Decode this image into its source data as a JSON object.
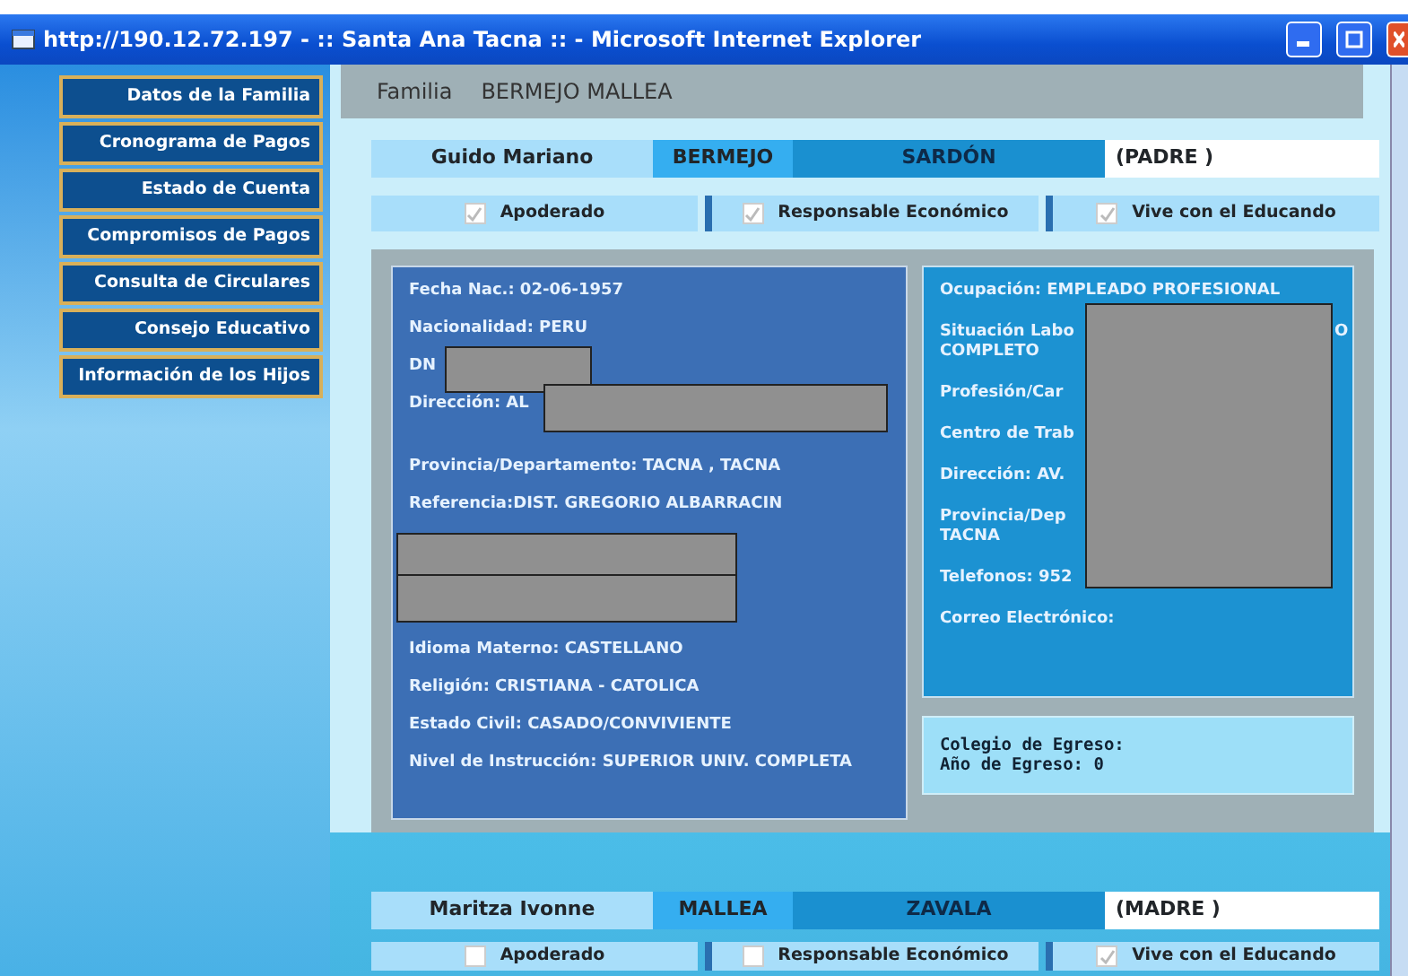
{
  "window": {
    "title": "http://190.12.72.197 - :: Santa Ana Tacna :: - Microsoft Internet Explorer"
  },
  "sidebar": {
    "items": [
      {
        "label": "Datos de la Familia"
      },
      {
        "label": "Cronograma de Pagos"
      },
      {
        "label": "Estado de Cuenta"
      },
      {
        "label": "Compromisos de Pagos"
      },
      {
        "label": "Consulta de Circulares"
      },
      {
        "label": "Consejo Educativo"
      },
      {
        "label": "Información de los Hijos"
      }
    ]
  },
  "header": {
    "label": "Familia",
    "value": "BERMEJO MALLEA"
  },
  "parents": [
    {
      "names": "Guido Mariano",
      "surname_1": "BERMEJO",
      "surname_2": "SARDÓN",
      "role": "(PADRE )",
      "checks": [
        {
          "label": "Apoderado",
          "checked": true
        },
        {
          "label": "Responsable Económico",
          "checked": true
        },
        {
          "label": "Vive con el Educando",
          "checked": true
        }
      ],
      "details": {
        "left": [
          {
            "text": "Fecha Nac.: 02-06-1957"
          },
          {
            "text": "Nacionalidad: PERU"
          },
          {
            "text": "DN",
            "redacted": true
          },
          {
            "text": "Dirección: AL",
            "redacted": true
          },
          {
            "text": "Provincia/Departamento: TACNA , TACNA"
          },
          {
            "text": "Referencia:DIST. GREGORIO ALBARRACIN"
          },
          {
            "kind": "redaction"
          },
          {
            "text": "Idioma Materno: CASTELLANO"
          },
          {
            "text": "Religión: CRISTIANA - CATOLICA"
          },
          {
            "text": "Estado Civil: CASADO/CONVIVIENTE"
          },
          {
            "text": "Nivel de Instrucción: SUPERIOR UNIV. COMPLETA"
          }
        ],
        "right": [
          {
            "text": "Ocupación: EMPLEADO PROFESIONAL"
          },
          {
            "text": "Situación Labo",
            "tail": "O",
            "second": "COMPLETO"
          },
          {
            "text": "Profesión/Car"
          },
          {
            "text": "Centro de Trab"
          },
          {
            "text": "Dirección: AV."
          },
          {
            "text": "Provincia/Dep",
            "second": "TACNA"
          },
          {
            "text": "Telefonos: 952"
          },
          {
            "text": "Correo Electrónico:"
          }
        ],
        "school": [
          "Colegio de Egreso:",
          "Año de Egreso: 0"
        ]
      }
    },
    {
      "names": "Maritza Ivonne",
      "surname_1": "MALLEA",
      "surname_2": "ZAVALA",
      "role": "(MADRE )",
      "checks": [
        {
          "label": "Apoderado",
          "checked": false
        },
        {
          "label": "Responsable Económico",
          "checked": false
        },
        {
          "label": "Vive con el Educando",
          "checked": true
        }
      ]
    }
  ]
}
